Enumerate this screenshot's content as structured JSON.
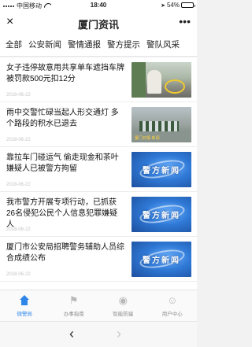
{
  "status_bar": {
    "carrier": "中国移动",
    "time": "18:40",
    "battery_percent": "54%",
    "battery_level": 0.54,
    "icons": [
      "signal-icon",
      "wifi-icon",
      "location-arrow-icon",
      "battery-icon"
    ]
  },
  "nav": {
    "title": "厦门资讯",
    "close_icon": "×",
    "more_icon": "•••"
  },
  "tabs": [
    {
      "label": "全部",
      "active": false
    },
    {
      "label": "公安新闻",
      "active": true
    },
    {
      "label": "警情通报",
      "active": false
    },
    {
      "label": "警方提示",
      "active": false
    },
    {
      "label": "警队风采",
      "active": false
    }
  ],
  "news": [
    {
      "title": "女子违停故意用共享单车遮挡车牌 被罚款500元扣12分",
      "date": "2018-06-22",
      "thumb": "photo-cyclist"
    },
    {
      "title": "雨中交警忙碌当起人形交通灯 多个路段的积水已退去",
      "date": "2018-06-22",
      "thumb": "photo-traffic-police",
      "thumb_caption": "厦门日报·新闻"
    },
    {
      "title": "靠拉车门碰运气 偷走现金和茶叶 嫌疑人已被警方拘留",
      "date": "2018-06-22",
      "thumb": "police-news-banner",
      "thumb_label": "警方新闻"
    },
    {
      "title": "我市警方开展专项行动，已抓获26名侵犯公民个人信息犯罪嫌疑人",
      "date": "2018-06-22",
      "thumb": "police-news-banner",
      "thumb_label": "警方新闻"
    },
    {
      "title": "厦门市公安局招聘警务辅助人员综合成绩公布",
      "date": "2018-06-22",
      "thumb": "police-news-banner",
      "thumb_label": "警方新闻"
    }
  ],
  "bottom_nav": [
    {
      "label": "微警局",
      "icon": "home-icon",
      "active": true
    },
    {
      "label": "办事指南",
      "icon": "guide-icon",
      "active": false
    },
    {
      "label": "智能防骗",
      "icon": "anti-fraud-icon",
      "active": false
    },
    {
      "label": "用户中心",
      "icon": "user-icon",
      "active": false
    }
  ],
  "browser": {
    "back_icon": "‹",
    "forward_icon": "›"
  },
  "colors": {
    "accent": "#2f86e8",
    "text": "#111111",
    "muted": "#c4c4c4"
  }
}
